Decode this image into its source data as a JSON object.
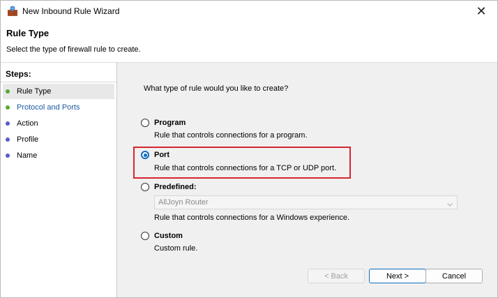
{
  "window": {
    "title": "New Inbound Rule Wizard",
    "close_glyph": "✕"
  },
  "header": {
    "title": "Rule Type",
    "subtitle": "Select the type of firewall rule to create."
  },
  "steps": {
    "heading": "Steps:",
    "items": [
      {
        "label": "Rule Type",
        "status": "complete",
        "color": "#5aa832"
      },
      {
        "label": "Protocol and Ports",
        "status": "current",
        "color": "#5aa832"
      },
      {
        "label": "Action",
        "status": "pending",
        "color": "#5a5acb"
      },
      {
        "label": "Profile",
        "status": "pending",
        "color": "#5a5acb"
      },
      {
        "label": "Name",
        "status": "pending",
        "color": "#5a5acb"
      }
    ]
  },
  "main": {
    "question": "What type of rule would you like to create?",
    "options": [
      {
        "label": "Program",
        "description": "Rule that controls connections for a program.",
        "checked": false
      },
      {
        "label": "Port",
        "description": "Rule that controls connections for a TCP or UDP port.",
        "checked": true
      },
      {
        "label": "Predefined:",
        "description": "Rule that controls connections for a Windows experience.",
        "checked": false
      },
      {
        "label": "Custom",
        "description": "Custom rule.",
        "checked": false
      }
    ],
    "predefined_select": {
      "value": "AllJoyn Router"
    }
  },
  "buttons": {
    "back": "< Back",
    "next": "Next >",
    "cancel": "Cancel"
  },
  "colors": {
    "accent": "#0f6cbd",
    "highlight": "#d6252f",
    "link_step": "#1f5aa5"
  }
}
